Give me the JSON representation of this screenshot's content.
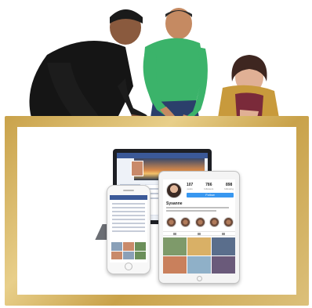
{
  "scene": {
    "board_color": "#c9a24a",
    "description_icons": [
      "people-group-illustration",
      "laptop-icon",
      "smartphone-icon",
      "tablet-icon"
    ]
  },
  "instagram": {
    "username": "Sysanne",
    "stats": [
      {
        "num": "107",
        "label": "posts"
      },
      {
        "num": "786",
        "label": "followers"
      },
      {
        "num": "898",
        "label": "following"
      }
    ],
    "follow_label": "Follow"
  }
}
